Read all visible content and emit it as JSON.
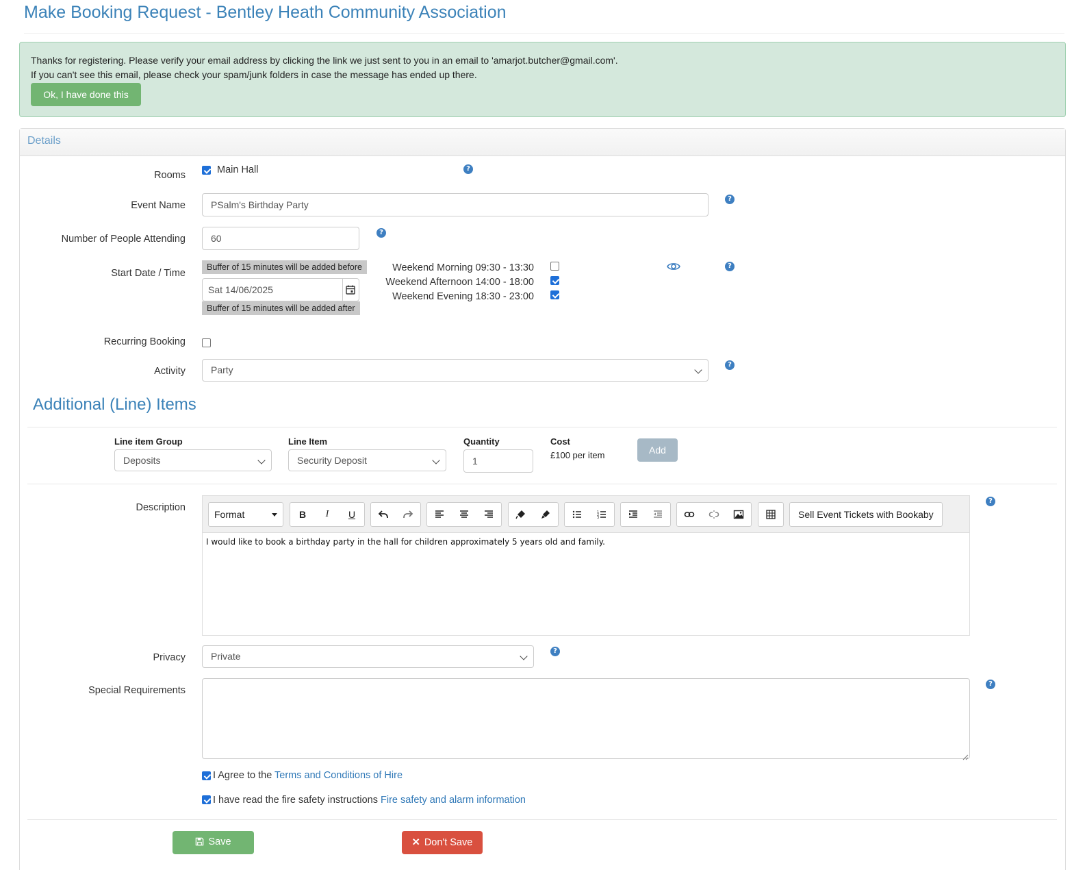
{
  "page": {
    "title": "Make Booking Request - Bentley Heath Community Association"
  },
  "alert": {
    "line1": "Thanks for registering. Please verify your email address by clicking the link we just sent to you in an email to 'amarjot.butcher@gmail.com'.",
    "line2": "If you can't see this email, please check your spam/junk folders in case the message has ended up there.",
    "ok_label": "Ok, I have done this"
  },
  "panel": {
    "heading": "Details"
  },
  "rooms": {
    "label": "Rooms",
    "option": "Main Hall",
    "checked": true
  },
  "event_name": {
    "label": "Event Name",
    "value": "PSalm's Birthday Party"
  },
  "attendees": {
    "label": "Number of People Attending",
    "value": "60"
  },
  "start": {
    "label": "Start Date / Time",
    "buffer_before": "Buffer of 15 minutes will be added before",
    "date": "Sat 14/06/2025",
    "buffer_after": "Buffer of 15 minutes will be added after",
    "slots": [
      {
        "label": "Weekend Morning 09:30 - 13:30",
        "checked": false
      },
      {
        "label": "Weekend Afternoon 14:00 - 18:00",
        "checked": true
      },
      {
        "label": "Weekend Evening 18:30 - 23:00",
        "checked": true
      }
    ]
  },
  "recurring": {
    "label": "Recurring Booking",
    "checked": false
  },
  "activity": {
    "label": "Activity",
    "value": "Party"
  },
  "line_items": {
    "title": "Additional (Line) Items",
    "group_label": "Line item Group",
    "group_value": "Deposits",
    "item_label": "Line Item",
    "item_value": "Security Deposit",
    "qty_label": "Quantity",
    "qty_value": "1",
    "cost_label": "Cost",
    "cost_value": "£100 per item",
    "add_label": "Add"
  },
  "description": {
    "label": "Description",
    "format_label": "Format",
    "bookaby_label": "Sell Event Tickets with Bookaby",
    "content": "I would like to book a birthday party in the hall for children approximately 5 years old and family."
  },
  "privacy": {
    "label": "Privacy",
    "value": "Private"
  },
  "special": {
    "label": "Special Requirements",
    "value": ""
  },
  "agreements": {
    "terms_prefix": "I Agree to the ",
    "terms_link": "Terms and Conditions of Hire",
    "fire_prefix": "I have read the fire safety instructions ",
    "fire_link": "Fire safety and alarm information"
  },
  "actions": {
    "save_label": "Save",
    "dont_save_label": "Don't Save"
  },
  "colors": {
    "accent": "#3b82b8",
    "success": "#72b572",
    "danger": "#d9503f",
    "checkbox": "#1e6fd8"
  }
}
